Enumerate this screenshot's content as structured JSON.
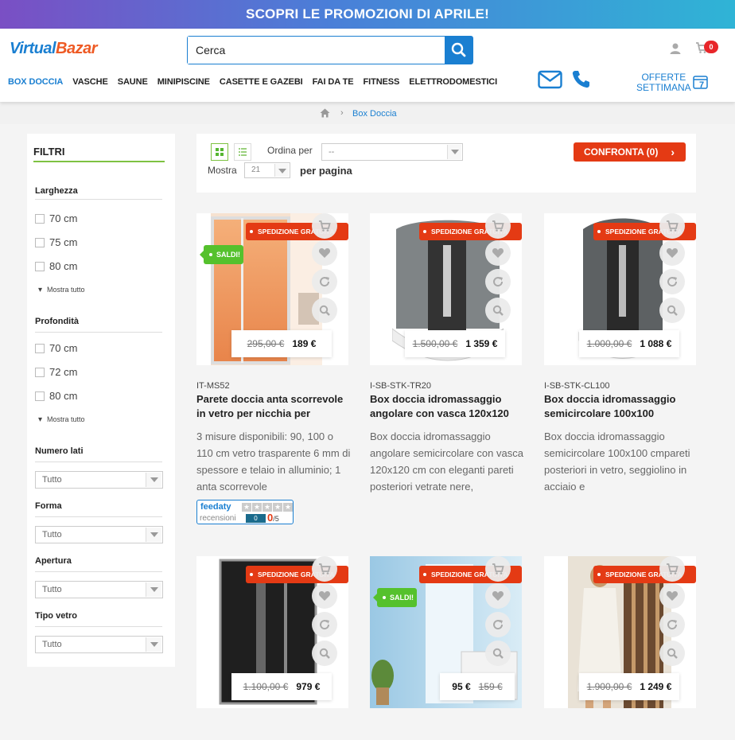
{
  "promo": {
    "text": "SCOPRI LE PROMOZIONI DI APRILE!"
  },
  "header": {
    "logo_part1": "Virtual",
    "logo_part2": "Bazar",
    "search_placeholder": "Cerca",
    "cart_count": "0",
    "offerte_line1": "OFFERTE",
    "offerte_line2": "SETTIMANA",
    "offerte_badge": "7",
    "nav": [
      "BOX DOCCIA",
      "VASCHE",
      "SAUNE",
      "MINIPISCINE",
      "CASETTE E GAZEBI",
      "FAI DA TE",
      "FITNESS",
      "ELETTRODOMESTICI"
    ],
    "colors": {
      "primary": "#1a7fd1",
      "accent": "#ee5a24"
    }
  },
  "breadcrumb": {
    "current": "Box Doccia"
  },
  "filters": {
    "title": "FILTRI",
    "larghezza": {
      "label": "Larghezza",
      "options": [
        "70 cm",
        "75 cm",
        "80 cm"
      ],
      "more": "Mostra tutto"
    },
    "profondita": {
      "label": "Profondità",
      "options": [
        "70 cm",
        "72 cm",
        "80 cm"
      ],
      "more": "Mostra tutto"
    },
    "numero_lati": {
      "label": "Numero lati",
      "value": "Tutto"
    },
    "forma": {
      "label": "Forma",
      "value": "Tutto"
    },
    "apertura": {
      "label": "Apertura",
      "value": "Tutto"
    },
    "tipo_vetro": {
      "label": "Tipo vetro",
      "value": "Tutto"
    }
  },
  "toolbar": {
    "ordina_label": "Ordina per",
    "ordina_value": "--",
    "mostra_label": "Mostra",
    "mostra_value": "21",
    "per_pagina": "per pagina",
    "confronta": "CONFRONTA (0)"
  },
  "badges": {
    "shipping": "SPEDIZIONE GRATUITA",
    "sale": "SALDI!"
  },
  "products": [
    {
      "sku": "IT-MS52",
      "title": "Parete doccia anta scorrevole in vetro per nicchia per",
      "desc": "3 misure disponibili: 90, 100 o 110 cm vetro trasparente 6 mm di spessore e telaio in alluminio;  1 anta scorrevole",
      "old_price": "295,00 €",
      "price": "189 €",
      "sale": true
    },
    {
      "sku": "I-SB-STK-TR20",
      "title": "Box doccia idromassaggio angolare con vasca 120x120",
      "desc": "Box doccia idromassaggio angolare semicircolare con vasca 120x120 cm con eleganti pareti posteriori vetrate nere,",
      "old_price": "1.500,00 €",
      "price": "1 359 €",
      "sale": false
    },
    {
      "sku": "I-SB-STK-CL100",
      "title": "Box doccia idromassaggio semicircolare 100x100",
      "desc": "Box doccia idromassaggio semicircolare 100x100 cmpareti posteriori in vetro, seggiolino in acciaio e",
      "old_price": "1.000,00 €",
      "price": "1 088 €",
      "sale": false
    },
    {
      "old_price": "1.100,00 €",
      "price": "979 €",
      "sale": false
    },
    {
      "old_price": "159 €",
      "price": "95 €",
      "sale": true
    },
    {
      "old_price": "1.900,00 €",
      "price": "1 249 €",
      "sale": false
    }
  ],
  "feedaty": {
    "logo": "feedaty",
    "label": "recensioni",
    "count": "0",
    "score": "0",
    "max": "/5"
  }
}
